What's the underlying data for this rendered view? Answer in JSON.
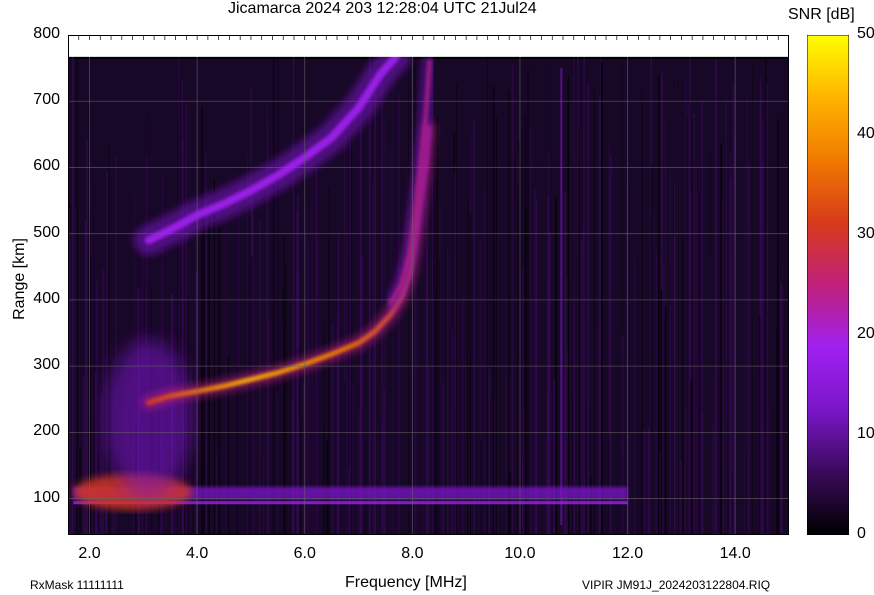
{
  "title": "Jicamarca 2024 203 12:28:04 UTC       21Jul24",
  "colorbar": {
    "title": "SNR [dB]",
    "range": [
      0,
      50
    ],
    "ticks": [
      "0",
      "10",
      "20",
      "30",
      "40",
      "50"
    ],
    "colormap": [
      "#000000",
      "#3a0a5a",
      "#7a16c8",
      "#a020f0",
      "#c0207a",
      "#d83a1a",
      "#f07a00",
      "#ffb400",
      "#ffff00"
    ]
  },
  "footer": {
    "left": "RxMask 11111111",
    "right": "VIPIR  JM91J_2024203122804.RIQ"
  },
  "chart_data": {
    "type": "heatmap",
    "title": "Jicamarca 2024 203 12:28:04 UTC       21Jul24",
    "xlabel": "Frequency [MHz]",
    "ylabel": "Range [km]",
    "xlim": [
      1.6,
      15.0
    ],
    "ylim": [
      45,
      800
    ],
    "xticks": [
      "2.0",
      "4.0",
      "6.0",
      "8.0",
      "10.0",
      "12.0",
      "14.0"
    ],
    "yticks": [
      "100",
      "200",
      "300",
      "400",
      "500",
      "600",
      "700",
      "800"
    ],
    "grid": true,
    "traces": [
      {
        "name": "",
        "snr_db": 42,
        "points": [
          [
            3.1,
            245
          ],
          [
            3.5,
            255
          ],
          [
            4.0,
            262
          ],
          [
            4.5,
            270
          ],
          [
            5.0,
            280
          ],
          [
            5.5,
            290
          ],
          [
            6.0,
            303
          ],
          [
            6.5,
            318
          ],
          [
            7.0,
            335
          ],
          [
            7.3,
            352
          ],
          [
            7.6,
            378
          ],
          [
            7.8,
            405
          ],
          [
            7.95,
            440
          ],
          [
            8.05,
            490
          ],
          [
            8.15,
            550
          ],
          [
            8.25,
            610
          ],
          [
            8.3,
            660
          ]
        ]
      },
      {
        "name": "",
        "snr_db": 28,
        "points": [
          [
            7.6,
            395
          ],
          [
            7.8,
            425
          ],
          [
            7.95,
            470
          ],
          [
            8.05,
            530
          ],
          [
            8.15,
            600
          ],
          [
            8.25,
            680
          ],
          [
            8.32,
            760
          ]
        ]
      },
      {
        "name": "",
        "snr_db": 18,
        "points": [
          [
            3.1,
            490
          ],
          [
            3.6,
            510
          ],
          [
            4.0,
            528
          ],
          [
            4.5,
            545
          ],
          [
            5.0,
            565
          ],
          [
            5.5,
            588
          ],
          [
            6.0,
            615
          ],
          [
            6.5,
            645
          ],
          [
            7.0,
            690
          ],
          [
            7.4,
            740
          ],
          [
            7.7,
            768
          ]
        ]
      }
    ],
    "e_layer": {
      "range_km": 110,
      "freq_start": 1.7,
      "freq_end": 12.0,
      "snr_db": 12
    },
    "sporadic_blob": {
      "range_km": 110,
      "freq_center": 2.8,
      "snr_db": 30
    }
  }
}
